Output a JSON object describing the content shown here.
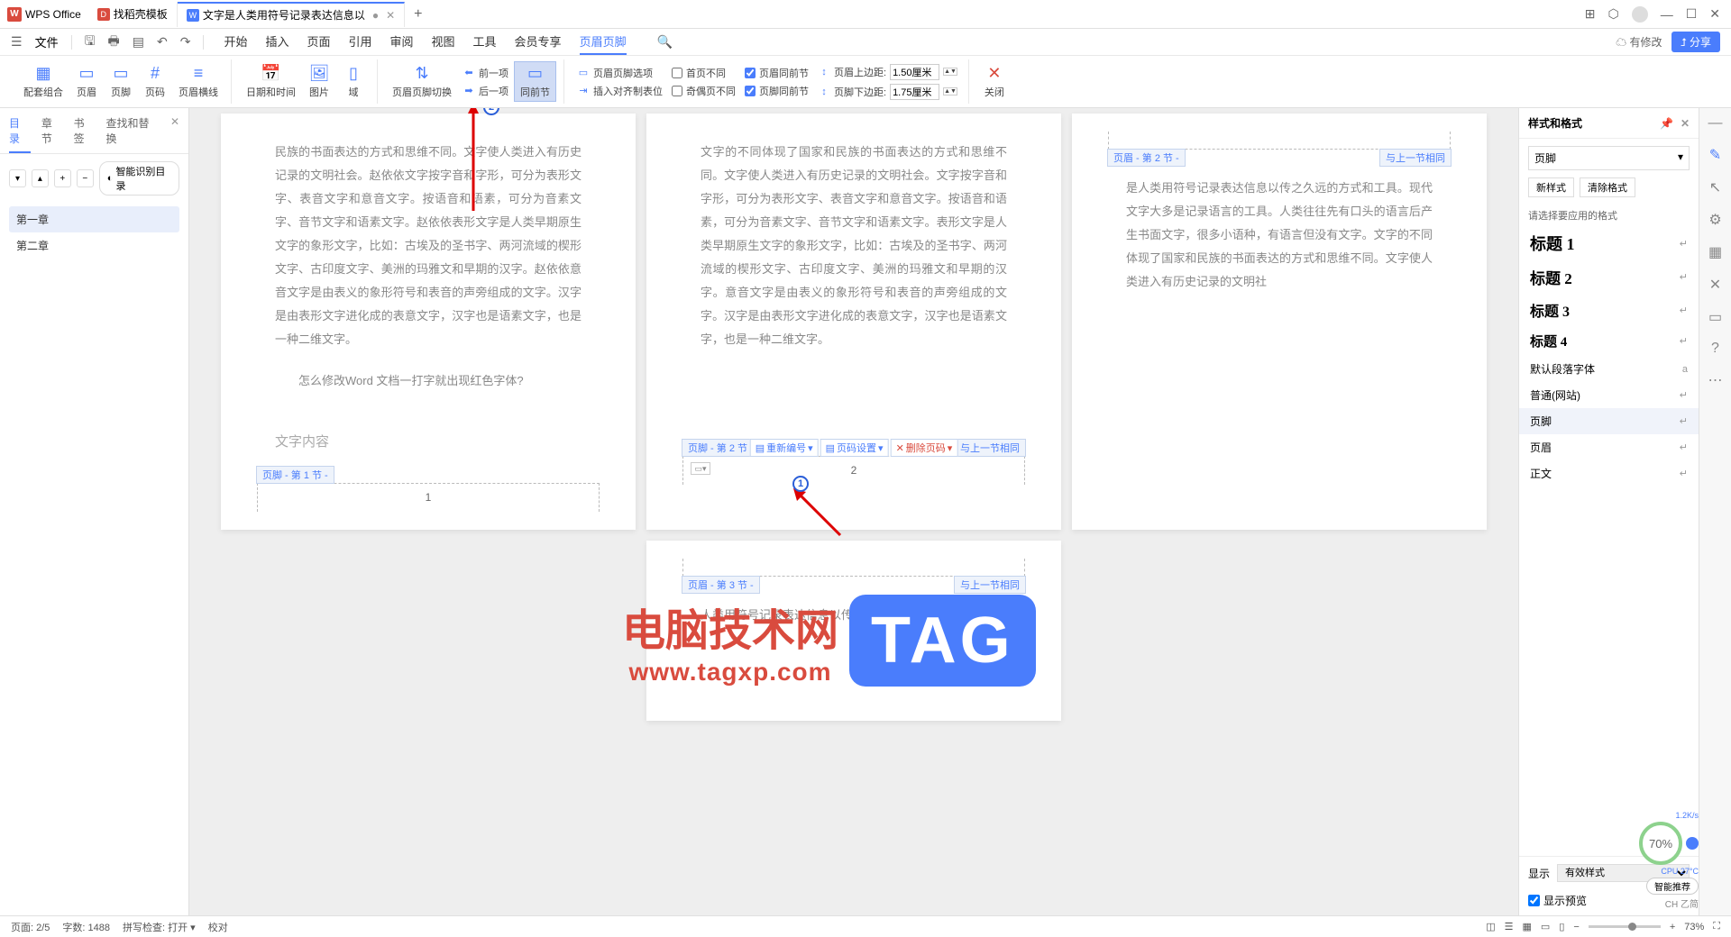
{
  "app": {
    "name": "WPS Office"
  },
  "tabs": [
    {
      "icon": "red",
      "label": "找稻壳模板"
    },
    {
      "icon": "blue",
      "label": "文字是人类用符号记录表达信息以",
      "modified": "●",
      "active": true
    }
  ],
  "window_controls": {
    "min": "—",
    "max": "☐",
    "close": "✕"
  },
  "quickbar": {
    "file": "文件"
  },
  "menus": [
    "开始",
    "插入",
    "页面",
    "引用",
    "审阅",
    "视图",
    "工具",
    "会员专享",
    "页眉页脚"
  ],
  "active_menu": "页眉页脚",
  "menubar_right": {
    "modified": "有修改",
    "share": "分享"
  },
  "ribbon": {
    "group1": {
      "combo": "配套组合",
      "header": "页眉",
      "footer": "页脚",
      "pagenum": "页码",
      "hline": "页眉横线"
    },
    "group2": {
      "datetime": "日期和时间",
      "image": "图片",
      "field": "域"
    },
    "group3": {
      "switch": "页眉页脚切换",
      "prev": "前一项",
      "next": "后一项",
      "sameprev": "同前节"
    },
    "group4": {
      "hf_opts": "页眉页脚选项",
      "first_diff": "首页不同",
      "insert_align": "插入对齐制表位",
      "odd_even_diff": "奇偶页不同",
      "header_same": "页眉同前节",
      "footer_same": "页脚同前节",
      "header_top": "页眉上边距:",
      "header_top_val": "1.50厘米",
      "footer_bot": "页脚下边距:",
      "footer_bot_val": "1.75厘米"
    },
    "close": "关闭"
  },
  "left_panel": {
    "tabs": [
      "目录",
      "章节",
      "书签",
      "查找和替换"
    ],
    "active": "目录",
    "smart": "智能识别目录",
    "items": [
      "第一章",
      "第二章"
    ]
  },
  "pages": {
    "p1": {
      "text1": "民族的书面表达的方式和思维不同。文字使人类进入有历史记录的文明社会。赵依依文字按字音和字形，可分为表形文字、表音文字和意音文字。按语音和语素，可分为音素文字、音节文字和语素文字。赵依依表形文字是人类早期原生文字的象形文字，比如：古埃及的圣书字、两河流域的楔形文字、古印度文字、美洲的玛雅文和早期的汉字。赵依依意音文字是由表义的象形符号和表音的声旁组成的文字。汉字是由表形文字进化成的表意文字，汉字也是语素文字，也是一种二维文字。",
      "q": "怎么修改Word 文档一打字就出现红色字体?",
      "heading": "文字内容",
      "footer_label": "页脚 - 第 1 节 -",
      "page_num": "1"
    },
    "p2": {
      "text1": "文字的不同体现了国家和民族的书面表达的方式和思维不同。文字使人类进入有历史记录的文明社会。文字按字音和字形，可分为表形文字、表音文字和意音文字。按语音和语素，可分为音素文字、音节文字和语素文字。表形文字是人类早期原生文字的象形文字，比如：古埃及的圣书字、两河流域的楔形文字、古印度文字、美洲的玛雅文和早期的汉字。意音文字是由表义的象形符号和表音的声旁组成的文字。汉字是由表形文字进化成的表意文字，汉字也是语素文字，也是一种二维文字。",
      "footer_label": "页脚 - 第 2 节 -",
      "page_num": "2",
      "same": "与上一节相同",
      "toolbar": {
        "renum": "重新编号",
        "pgset": "页码设置",
        "del": "删除页码"
      }
    },
    "p3": {
      "header_label": "页眉 - 第 2 节 -",
      "same": "与上一节相同",
      "text": "是人类用符号记录表达信息以传之久远的方式和工具。现代文字大多是记录语言的工具。人类往往先有口头的语言后产生书面文字，很多小语种，有语言但没有文字。文字的不同体现了国家和民族的书面表达的方式和思维不同。文字使人类进入有历史记录的文明社"
    },
    "p4": {
      "header_label": "页眉 - 第 3 节 -",
      "same": "与上一节相同",
      "text": "人类用符号记录表达信息以传之久远的方式和工具"
    }
  },
  "right_panel": {
    "title": "样式和格式",
    "selected": "页脚",
    "new_style": "新样式",
    "clear": "清除格式",
    "hint": "请选择要应用的格式",
    "styles": [
      {
        "name": "标题 1",
        "cls": "h1"
      },
      {
        "name": "标题 2",
        "cls": "h2"
      },
      {
        "name": "标题 3",
        "cls": "h3"
      },
      {
        "name": "标题 4",
        "cls": "h4"
      },
      {
        "name": "默认段落字体",
        "cls": ""
      },
      {
        "name": "普通(网站)",
        "cls": ""
      },
      {
        "name": "页脚",
        "cls": "",
        "sel": true
      },
      {
        "name": "页眉",
        "cls": ""
      },
      {
        "name": "正文",
        "cls": ""
      }
    ],
    "show_label": "显示",
    "show_value": "有效样式",
    "preview": "显示预览"
  },
  "watermark": {
    "text": "电脑技术网",
    "tag": "TAG",
    "url": "www.tagxp.com"
  },
  "statusbar": {
    "page": "页面: 2/5",
    "words": "字数: 1488",
    "spell": "拼写检查: 打开",
    "proof": "校对",
    "zoom": "73%"
  },
  "perf": {
    "pct": "70%",
    "net": "1.2K/s",
    "cpu": "CPU 27°C",
    "smart": "智能推荐",
    "ime": "CH 乙简"
  }
}
